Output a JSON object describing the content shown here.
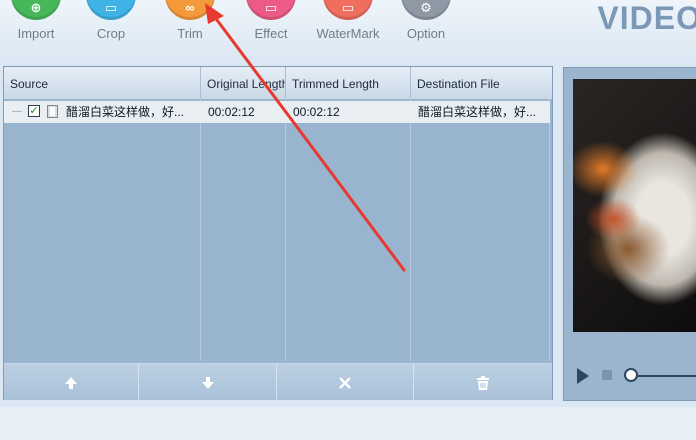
{
  "toolbar": {
    "tools": [
      {
        "id": "import",
        "label": "Import",
        "color": "#46b85b",
        "glyph": "⊕"
      },
      {
        "id": "crop",
        "label": "Crop",
        "color": "#3fb3e6",
        "glyph": "▭"
      },
      {
        "id": "trim",
        "label": "Trim",
        "color": "#f59a3a",
        "glyph": "∞"
      },
      {
        "id": "effect",
        "label": "Effect",
        "color": "#ec5b86",
        "glyph": "▭"
      },
      {
        "id": "watermark",
        "label": "WaterMark",
        "color": "#ef6e5e",
        "glyph": "▭"
      },
      {
        "id": "option",
        "label": "Option",
        "color": "#8f99a5",
        "glyph": "⚙"
      }
    ],
    "brand": "VIDEO"
  },
  "table": {
    "columns": [
      "Source",
      "Original Length",
      "Trimmed Length",
      "Destination File"
    ],
    "rows": [
      {
        "checked": true,
        "source": "醋溜白菜这样做，好...",
        "original_length": "00:02:12",
        "trimmed_length": "00:02:12",
        "destination": "醋溜白菜这样做，好..."
      }
    ],
    "footer_buttons": [
      {
        "id": "move-up",
        "icon": "arrow-up-icon"
      },
      {
        "id": "move-down",
        "icon": "arrow-down-icon"
      },
      {
        "id": "remove",
        "icon": "close-icon"
      },
      {
        "id": "clear",
        "icon": "trash-icon"
      }
    ]
  },
  "preview": {
    "playback_position": 0
  },
  "annotation": {
    "color": "#e8392f"
  }
}
